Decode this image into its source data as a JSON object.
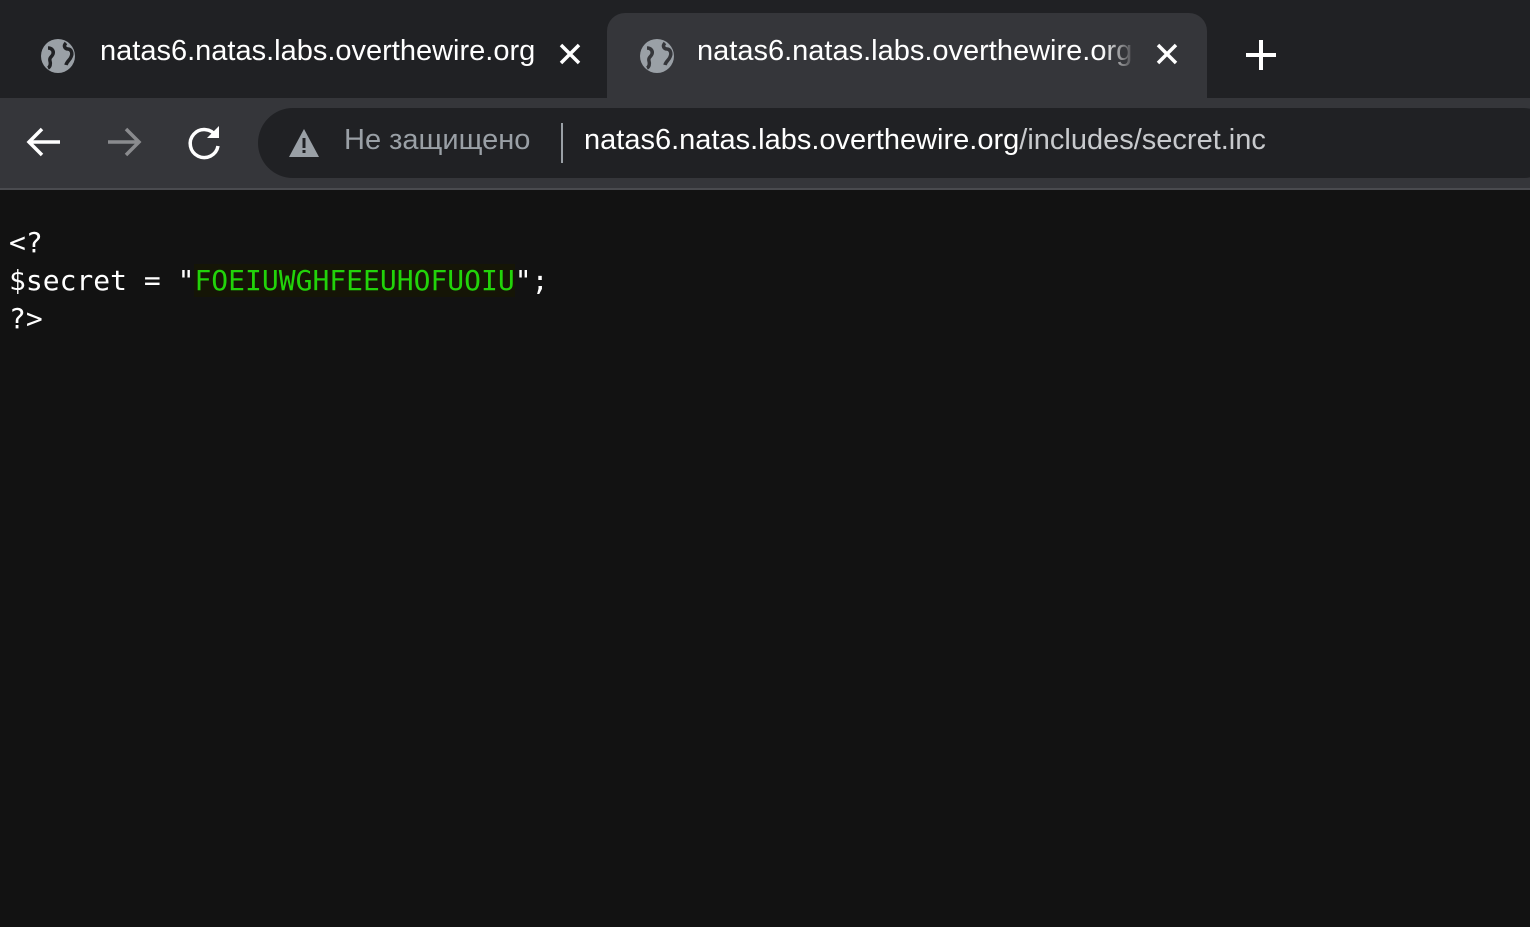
{
  "tabs": [
    {
      "title": "natas6.natas.labs.overthewire.org",
      "icon": "globe-icon",
      "active": false
    },
    {
      "title": "natas6.natas.labs.overthewire.org",
      "icon": "globe-icon",
      "active": true
    }
  ],
  "toolbar": {
    "security_label": "Не защищено",
    "url_host": "natas6.natas.labs.overthewire.org",
    "url_path": "/includes/secret.inc"
  },
  "page": {
    "line1": "<?",
    "line2_prefix": "$secret = \"",
    "secret_value": "FOEIUWGHFEEUHOFUOIU",
    "line2_suffix": "\";",
    "line3": "?>"
  },
  "colors": {
    "secret": "#22d30a",
    "tabstrip": "#202124",
    "toolbar": "#35363a",
    "page_bg": "#121212"
  }
}
